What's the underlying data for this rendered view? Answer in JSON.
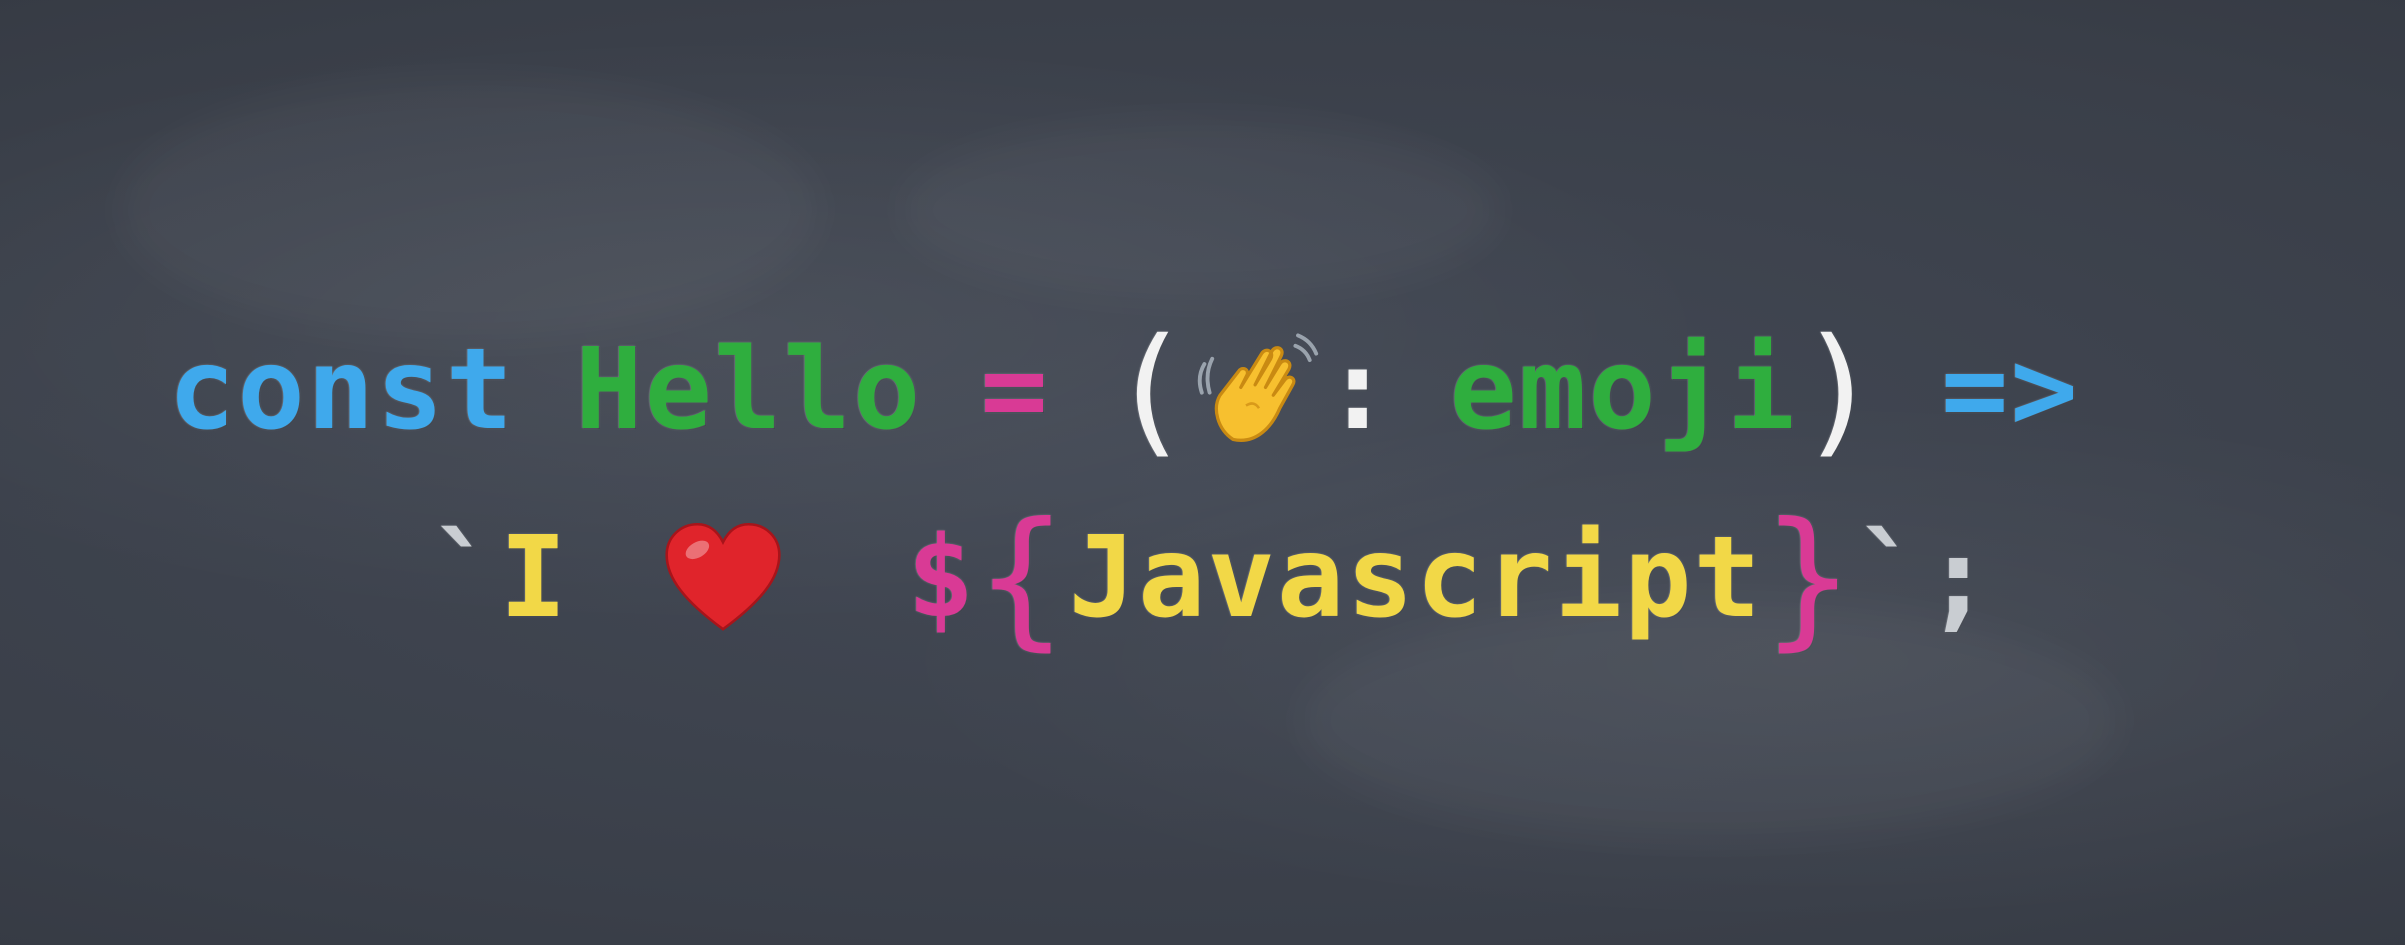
{
  "line1": {
    "keyword": "const",
    "name": "Hello",
    "equals": "=",
    "open_paren": "(",
    "colon": ":",
    "param_type": "emoji",
    "close_paren": ")",
    "arrow": "=>",
    "hand_icon": "waving-hand-icon"
  },
  "line2": {
    "open_backtick": "`",
    "word_i": "I",
    "heart_icon": "red-heart-icon",
    "dollar": "$",
    "open_brace": "{",
    "interpolated": "Javascript",
    "close_brace": "}",
    "close_backtick": "`",
    "semicolon": ";"
  },
  "colors": {
    "board": "#3a3f49",
    "keyword_blue": "#3fa9ec",
    "name_green": "#2fae3e",
    "operator_pink": "#d93a95",
    "paren_white": "#f2f2f2",
    "string_yellow": "#f2d847",
    "punct_grey": "#c9cdd2",
    "heart_red": "#e0242b",
    "hand_yellow": "#f7c02f"
  }
}
